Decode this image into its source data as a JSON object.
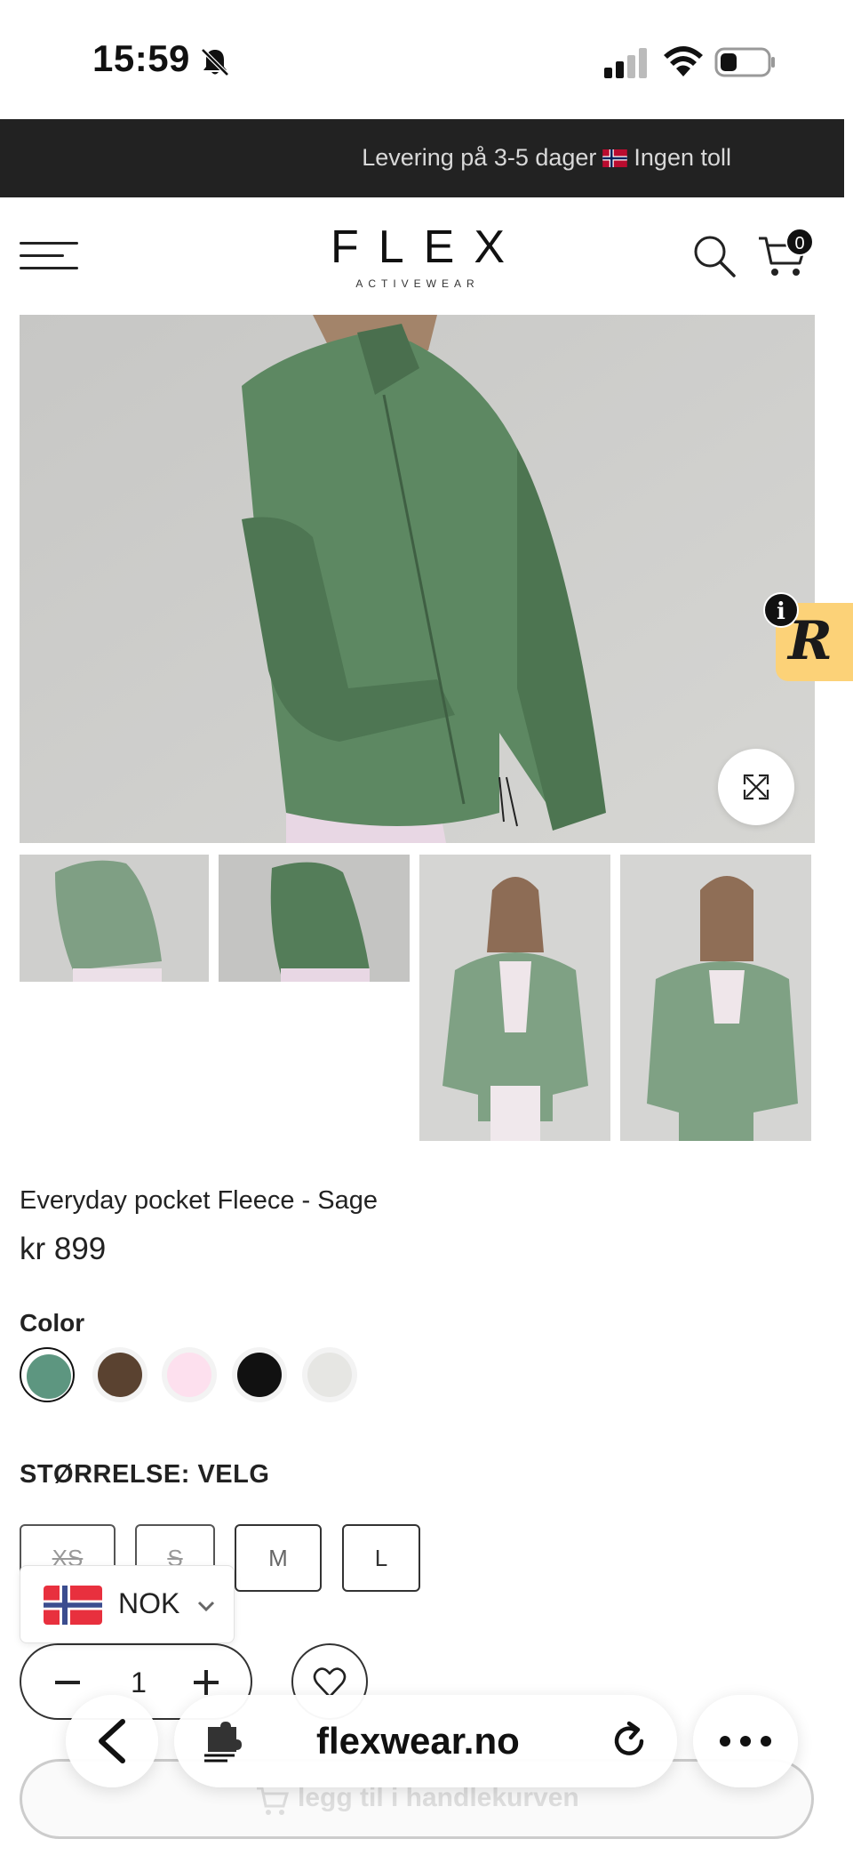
{
  "status_bar": {
    "time": "15:59",
    "icons": [
      "bell-slash-icon",
      "signal-icon",
      "wifi-icon",
      "battery-icon"
    ]
  },
  "announcement": {
    "text_before_flag": "Levering på 3-5 dager",
    "text_after_flag": "Ingen toll",
    "flag": "norway-flag"
  },
  "header": {
    "logo_main": "FLEX",
    "logo_sub": "ACTIVEWEAR",
    "cart_count": "0",
    "icons": [
      "menu-icon",
      "search-icon",
      "cart-icon"
    ]
  },
  "gallery": {
    "main_image_alt": "Everyday pocket Fleece - Sage",
    "thumbnail_count": 4,
    "expand_icon": "expand-icon"
  },
  "review_widget": {
    "letter": "R",
    "info": "i",
    "color": "#fcd278"
  },
  "product": {
    "title": "Everyday pocket Fleece - Sage",
    "price": "kr 899",
    "color_label": "Color",
    "colors": [
      {
        "name": "Sage",
        "hex": "#5d9680",
        "selected": true
      },
      {
        "name": "Brown",
        "hex": "#5a4230",
        "selected": false
      },
      {
        "name": "Pink",
        "hex": "#fde0ee",
        "selected": false
      },
      {
        "name": "Black",
        "hex": "#111111",
        "selected": false
      },
      {
        "name": "Light grey",
        "hex": "#e6e6e3",
        "selected": false
      }
    ],
    "size_label": "STØRRELSE: VELG",
    "sizes": [
      "XS",
      "S",
      "M",
      "L"
    ],
    "quantity": "1",
    "add_to_cart": "legg til i handlekurven"
  },
  "currency": {
    "code": "NOK"
  },
  "browser_bar": {
    "url": "flexwear.no",
    "icons": [
      "back-icon",
      "extension-icon",
      "reload-icon",
      "more-icon"
    ]
  }
}
